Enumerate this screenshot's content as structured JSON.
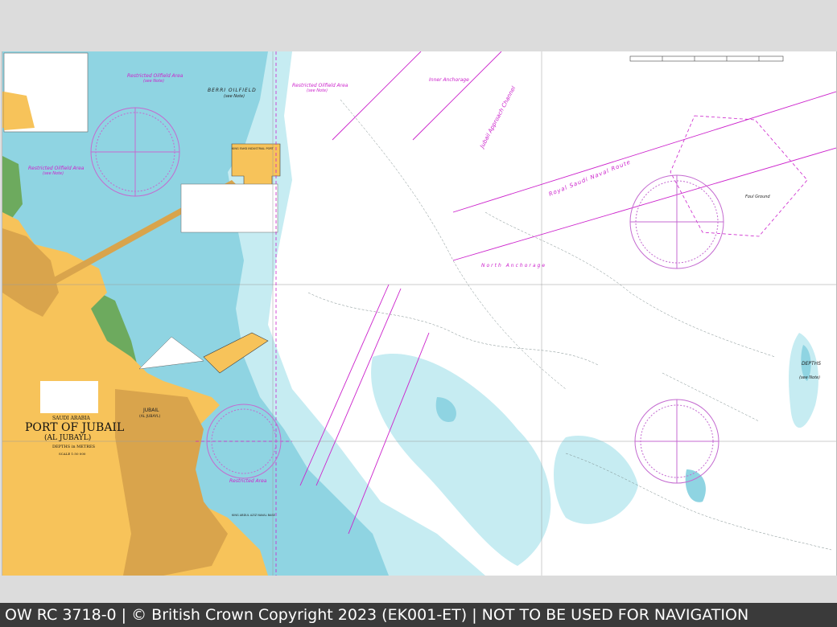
{
  "footer": {
    "text": "OW RC 3718-0 | © British Crown Copyright 2023 (EK001-ET) | NOT TO BE USED FOR NAVIGATION"
  },
  "chart": {
    "country": "SAUDI ARABIA",
    "title": "PORT OF JUBAIL",
    "subtitle": "(AL JUBAYL)",
    "depths_unit": "DEPTHS in METRES",
    "scale": "SCALE 1:50 000",
    "town_label": "JUBAIL",
    "town_label_alt": "(AL JUBAYL)",
    "labels": {
      "restricted_oilfield_1": "Restricted Oilfield Area",
      "restricted_oilfield_1_note": "(see Note)",
      "restricted_oilfield_2": "Restricted Oilfield Area",
      "restricted_oilfield_2_note": "(see Note)",
      "restricted_oilfield_3": "Restricted Oilfield Area",
      "restricted_oilfield_3_note": "(see Note)",
      "restricted_area": "Restricted Area",
      "berri_oilfield": "BERRI OILFIELD",
      "berri_note": "(see Note)",
      "inner_anchorage": "Inner Anchorage",
      "approach_channel": "Jubail Approach Channel",
      "royal_saudi_naval_route": "Royal Saudi Naval Route",
      "north_anchorage": "North Anchorage",
      "foul_ground": "Foul Ground",
      "depths_note": "DEPTHS",
      "depths_note_2": "(see Note)",
      "king_fahd_port": "KING FAHD INDUSTRIAL PORT",
      "naval_base": "KING ABDUL AZIZ NAVAL BASE"
    },
    "colors": {
      "land": "#f7c35a",
      "built_up": "#d9a44c",
      "shallow": "#8fd4e2",
      "medium": "#c6ecf2",
      "deep": "#ffffff",
      "magenta": "#cc22cc",
      "green_intertidal": "#6daa5e"
    }
  }
}
